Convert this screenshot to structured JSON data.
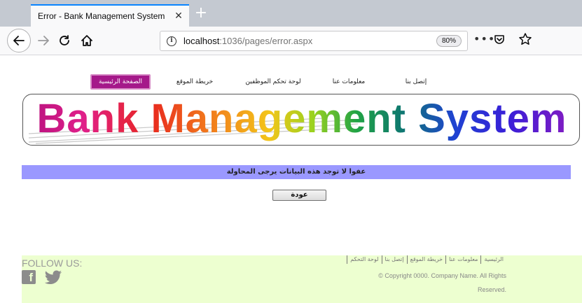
{
  "browser": {
    "tab_title": "Error - Bank Management System",
    "tab_close": "✕",
    "new_tab": "+",
    "url_host": "localhost",
    "url_path": ":1036/pages/error.aspx",
    "zoom": "80%",
    "icons": [
      "back-arrow-icon",
      "forward-arrow-icon",
      "reload-icon",
      "home-icon",
      "info-icon",
      "page-actions-icon",
      "pocket-icon",
      "bookmark-star-icon"
    ]
  },
  "site": {
    "menu": {
      "home": "الصفحة الرئيسية",
      "sitemap": "خريطة الموقع",
      "employee_panel": "لوحة تحكم الموظفين",
      "about": "معلومات عنا",
      "contact": "إتصل بنا"
    },
    "banner_title": "Bank Management System",
    "error_message": "عفوا لا توجد هذه البيانات يرجى المحاولة",
    "back_button": "عودة",
    "footer": {
      "follow": "FOLLOW US:",
      "facebook_glyph": "f",
      "links": [
        "الرئيسية",
        "معلومات عنا",
        "خريطة الموقع",
        "إتصل بنا",
        "لوحة التحكم"
      ],
      "copyright_line1": "© Copyright 0000. Company Name. All Rights",
      "copyright_line2": "Reserved."
    }
  },
  "colors": {
    "menu_active": "#a5198a",
    "error_bar": "#9a98ff",
    "footer_bg": "#edffd0",
    "tab_accent": "#0a84ff"
  }
}
